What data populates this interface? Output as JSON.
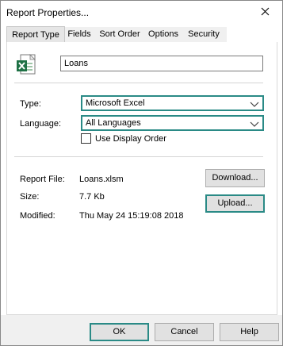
{
  "window": {
    "title": "Report Properties..."
  },
  "tabs": [
    {
      "label": "Report Type",
      "active": true
    },
    {
      "label": "Fields",
      "active": false
    },
    {
      "label": "Sort Order",
      "active": false
    },
    {
      "label": "Options",
      "active": false
    },
    {
      "label": "Security",
      "active": false
    }
  ],
  "report": {
    "name": "Loans",
    "type_label": "Type:",
    "type_value": "Microsoft Excel",
    "language_label": "Language:",
    "language_value": "All Languages",
    "display_order_label": "Use Display Order",
    "display_order_checked": false
  },
  "file_info": {
    "file_label": "Report File:",
    "file_value": "Loans.xlsm",
    "size_label": "Size:",
    "size_value": "7.7 Kb",
    "modified_label": "Modified:",
    "modified_value": "Thu May 24 15:19:08 2018"
  },
  "buttons": {
    "download": "Download...",
    "upload": "Upload...",
    "ok": "OK",
    "cancel": "Cancel",
    "help": "Help"
  },
  "colors": {
    "accent": "#2a8a86",
    "excel_green": "#1e7145"
  },
  "icons": {
    "file": "excel-file-icon",
    "close": "close-icon",
    "chevron": "chevron-down-icon"
  }
}
